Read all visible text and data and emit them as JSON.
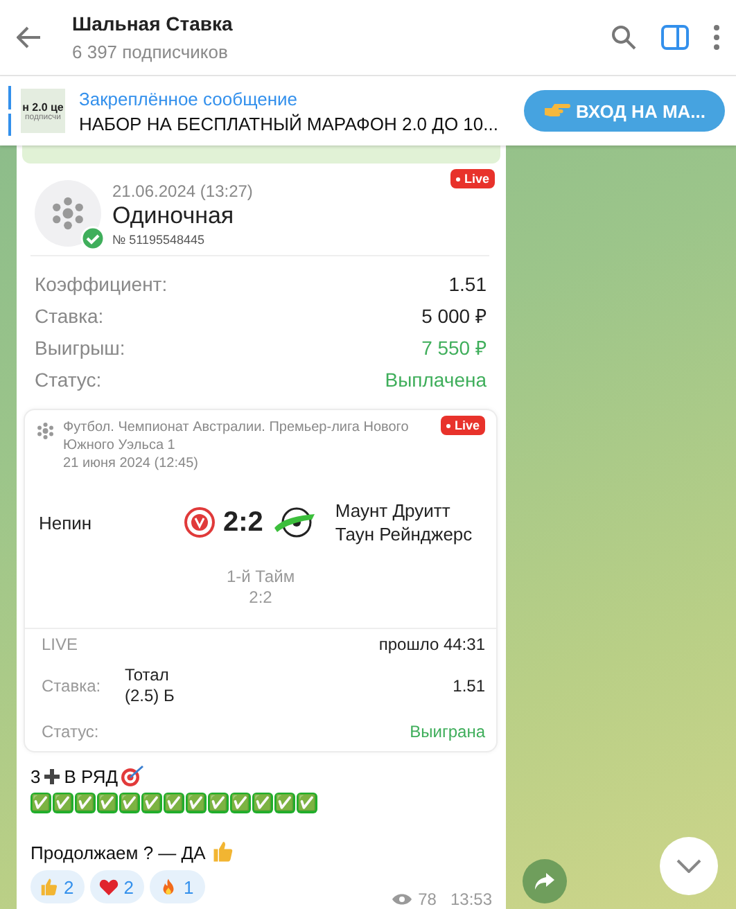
{
  "header": {
    "title": "Шальная Ставка",
    "subtitle": "6 397 подписчиков"
  },
  "pinned": {
    "thumb_lines": [
      "н 2.0 це",
      "подписчи"
    ],
    "label": "Закреплённое сообщение",
    "text": "НАБОР НА БЕСПЛАТНЫЙ МАРАФОН 2.0 ДО 10...",
    "button": "ВХОД НА МА..."
  },
  "slip": {
    "date": "21.06.2024 (13:27)",
    "type": "Одиночная",
    "number": "№ 51195548445",
    "badge": "Live",
    "settled": true,
    "rows": [
      {
        "label": "Коэффициент:",
        "value": "1.51",
        "kind": "plain"
      },
      {
        "label": "Ставка:",
        "value": "5 000 ₽",
        "kind": "plain"
      },
      {
        "label": "Выигрыш:",
        "value": "7 550 ₽",
        "kind": "positive"
      },
      {
        "label": "Статус:",
        "value": "Выплачена",
        "kind": "positive"
      }
    ]
  },
  "event": {
    "badge": "Live",
    "league": "Футбол. Чемпионат Австралии. Премьер-лига Нового Южного Уэльса 1",
    "date": "21 июня 2024 (12:45)",
    "home": "Непин",
    "score": "2:2",
    "away": "Маунт Друитт Таун Рейнджерс",
    "period": "1-й Тайм",
    "period_score": "2:2",
    "live": "LIVE",
    "elapsed": "прошло 44:31",
    "stake_label": "Ставка:",
    "selection": "Тотал (2.5) Б",
    "odds": "1.51",
    "status_label": "Статус:",
    "status": "Выиграна"
  },
  "caption": {
    "count": "3",
    "headline": "В РЯД",
    "checks": "✅✅✅✅✅✅✅✅✅✅✅✅✅",
    "question": "Продолжаем ? — ДА"
  },
  "reactions": [
    {
      "kind": "thumbs",
      "count": "2"
    },
    {
      "kind": "heart",
      "count": "2"
    },
    {
      "kind": "fire",
      "count": "1"
    }
  ],
  "views": "78",
  "time": "13:53"
}
